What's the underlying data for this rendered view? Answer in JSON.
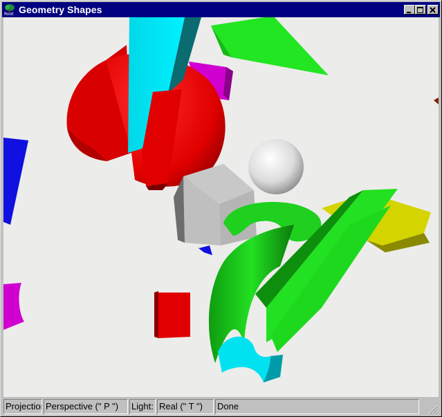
{
  "window": {
    "title": "Geometry Shapes",
    "app_icon_label": "Root"
  },
  "status": {
    "projection_label": "Projection",
    "projection_value": "Perspective (\" P \")",
    "light_label": "Light:",
    "light_value": "Real (\" T \")",
    "message": "Done"
  },
  "colors": {
    "title_bar": "#000080",
    "canvas_bg": "#ececea"
  },
  "icons": [
    "root-tree-icon",
    "minimize-icon",
    "maximize-icon",
    "close-icon",
    "size-grip-icon"
  ]
}
